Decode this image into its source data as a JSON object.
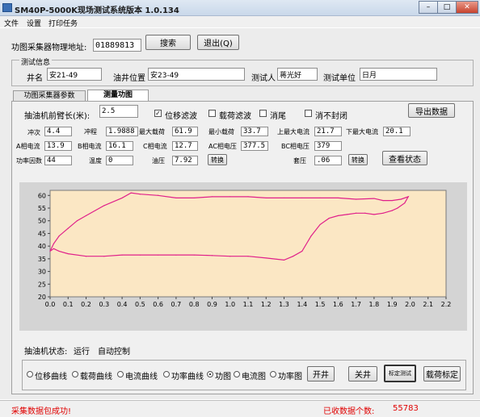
{
  "window": {
    "title": "SM40P-5000K现场测试系统版本 1.0.134",
    "minimize": "–",
    "maximize": "□",
    "close": "✕"
  },
  "menu": [
    "文件",
    "设置",
    "打印任务"
  ],
  "top": {
    "address_label": "功图采集器物理地址:",
    "address_value": "01889813",
    "search": "搜索",
    "exit": "退出(Q)"
  },
  "test_info": {
    "group": "测试信息",
    "well_label": "井名",
    "well_value": "安21-49",
    "pos_label": "油井位置",
    "pos_value": "安23-49",
    "tester_label": "测试人",
    "tester_value": "蒋光好",
    "unit_label": "测试单位",
    "unit_value": "日月"
  },
  "tabs": [
    "功图采集器参数",
    "测量功图"
  ],
  "measure": {
    "arm_label": "抽油机前臂长(米):",
    "arm_value": "2.5",
    "filters": [
      {
        "label": "位移滤波",
        "checked": true
      },
      {
        "label": "载荷滤波",
        "checked": false
      },
      {
        "label": "消尾",
        "checked": false
      },
      {
        "label": "消不封闭",
        "checked": false
      }
    ],
    "export": "导出数据",
    "row1": [
      {
        "label": "冲次",
        "value": "4.4"
      },
      {
        "label": "冲程",
        "value": "1.9888"
      },
      {
        "label": "最大载荷",
        "value": "61.9"
      },
      {
        "label": "最小载荷",
        "value": "33.7"
      },
      {
        "label": "上最大电流",
        "value": "21.7"
      },
      {
        "label": "下最大电流",
        "value": "20.1"
      }
    ],
    "row2": [
      {
        "label": "A相电流",
        "value": "13.9"
      },
      {
        "label": "B相电流",
        "value": "16.1"
      },
      {
        "label": "C相电流",
        "value": "12.7"
      },
      {
        "label": "AC相电压",
        "value": "377.5"
      },
      {
        "label": "BC相电压",
        "value": "379"
      }
    ],
    "row3": [
      {
        "label": "功率因数",
        "value": "44"
      },
      {
        "label": "温度",
        "value": "0"
      },
      {
        "label": "油压",
        "value": "7.92"
      },
      {
        "label": "套压",
        "value": ".06"
      }
    ],
    "convert": "转换",
    "view_status": "查看状态"
  },
  "chart_data": {
    "type": "line",
    "title": "",
    "xlabel": "",
    "ylabel": "",
    "xlim": [
      0,
      2.2
    ],
    "ylim": [
      20,
      62
    ],
    "x_ticks": [
      "0.0",
      "0.1",
      "0.2",
      "0.3",
      "0.4",
      "0.5",
      "0.6",
      "0.7",
      "0.8",
      "0.9",
      "1.0",
      "1.1",
      "1.2",
      "1.3",
      "1.4",
      "1.5",
      "1.6",
      "1.7",
      "1.8",
      "1.9",
      "2.0",
      "2.1",
      "2.2"
    ],
    "y_ticks": [
      "20",
      "25",
      "30",
      "35",
      "40",
      "45",
      "50",
      "55",
      "60"
    ],
    "grid": false,
    "series_color": "#e0208a",
    "x": [
      0.0,
      0.02,
      0.05,
      0.1,
      0.15,
      0.2,
      0.3,
      0.4,
      0.45,
      0.5,
      0.6,
      0.7,
      0.8,
      0.9,
      1.0,
      1.1,
      1.2,
      1.3,
      1.4,
      1.5,
      1.6,
      1.7,
      1.8,
      1.85,
      1.9,
      1.95,
      1.99,
      1.97,
      1.93,
      1.9,
      1.85,
      1.8,
      1.75,
      1.7,
      1.65,
      1.6,
      1.55,
      1.5,
      1.45,
      1.4,
      1.35,
      1.3,
      1.2,
      1.1,
      1.0,
      0.9,
      0.8,
      0.7,
      0.6,
      0.5,
      0.4,
      0.3,
      0.2,
      0.1,
      0.05,
      0.02,
      0.0
    ],
    "y": [
      38,
      41,
      44,
      47,
      50,
      52,
      56,
      59,
      61,
      60.5,
      60,
      59,
      59,
      59.5,
      59.5,
      59.5,
      59,
      59,
      59,
      59,
      59,
      58.5,
      58.8,
      58,
      58,
      58.5,
      59.5,
      57,
      55,
      54,
      53,
      52.5,
      53,
      53,
      52.5,
      52,
      51,
      48.5,
      44,
      38,
      36,
      34.5,
      35.3,
      36,
      36,
      36.3,
      36.5,
      36.5,
      36.5,
      36.5,
      36.5,
      36,
      36,
      37,
      38,
      39,
      38
    ]
  },
  "bottom": {
    "status_label": "抽油机状态:",
    "status_value": "运行",
    "control": "自动控制",
    "radios": [
      {
        "label": "位移曲线",
        "on": false
      },
      {
        "label": "载荷曲线",
        "on": false
      },
      {
        "label": "电流曲线",
        "on": false
      },
      {
        "label": "功率曲线",
        "on": false
      },
      {
        "label": "功图",
        "on": true
      },
      {
        "label": "电流图",
        "on": false
      },
      {
        "label": "功率图",
        "on": false
      }
    ],
    "open_well": "开井",
    "close_well": "关井",
    "calibrate_test": "标定测试",
    "load_calibration": "载荷标定"
  },
  "statusbar": {
    "left": "采集数据包成功!",
    "count_label": "已收数据个数:",
    "count_value": "55783"
  }
}
